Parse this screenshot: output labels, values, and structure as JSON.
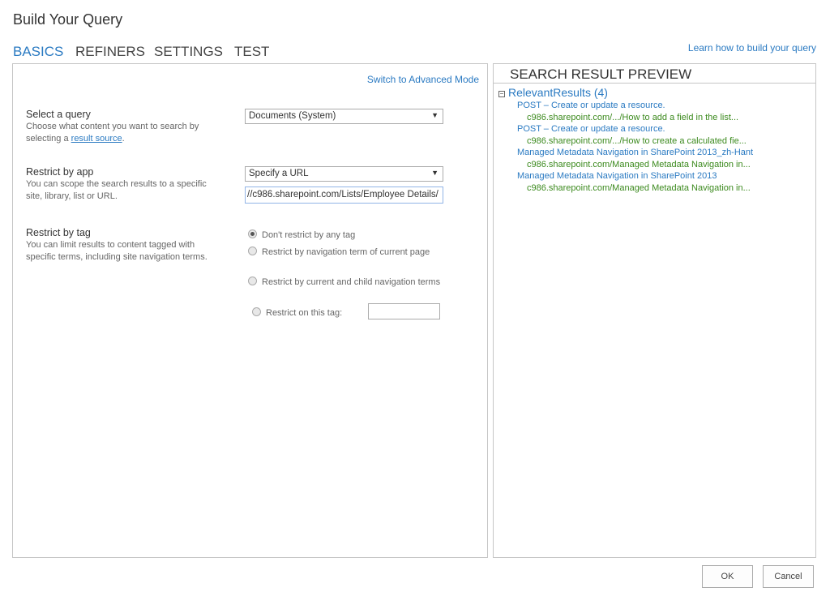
{
  "title": "Build Your Query",
  "tabs": [
    "BASICS",
    "REFINERS",
    "SETTINGS",
    "TEST"
  ],
  "learn_link": "Learn how to build your query",
  "advanced_link": "Switch to Advanced Mode",
  "query": {
    "label": "Select a query",
    "desc_pre": "Choose what content you want to search by selecting a ",
    "desc_link": "result source",
    "desc_post": ".",
    "value": "Documents (System)"
  },
  "app": {
    "label": "Restrict by app",
    "desc": "You can scope the search results to a specific site, library, list or URL.",
    "value": "Specify a URL",
    "url": "//c986.sharepoint.com/Lists/Employee Details/"
  },
  "tag": {
    "label": "Restrict by tag",
    "desc": "You can limit results to content tagged with specific terms, including site navigation terms.",
    "options": [
      "Don't restrict by any tag",
      "Restrict by navigation term of current page",
      "Restrict by current and child navigation terms",
      "Restrict on this tag:"
    ],
    "selected": 0,
    "tag_value": ""
  },
  "preview": {
    "title": "SEARCH RESULT PREVIEW",
    "group": "RelevantResults (4)",
    "collapse_icon": "minus-box",
    "results": [
      {
        "title": "POST – Create or update a resource.",
        "url": "c986.sharepoint.com/.../How to add a field in the list..."
      },
      {
        "title": "POST – Create or update a resource.",
        "url": "c986.sharepoint.com/.../How to create a calculated fie..."
      },
      {
        "title": "Managed Metadata Navigation in SharePoint 2013_zh-Hant",
        "url": "c986.sharepoint.com/Managed Metadata Navigation in..."
      },
      {
        "title": "Managed Metadata Navigation in SharePoint 2013",
        "url": "c986.sharepoint.com/Managed Metadata Navigation in..."
      }
    ]
  },
  "buttons": {
    "ok": "OK",
    "cancel": "Cancel"
  }
}
